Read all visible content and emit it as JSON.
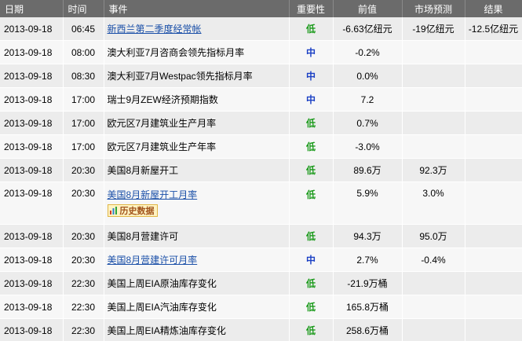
{
  "headers": {
    "date": "日期",
    "time": "时间",
    "event": "事件",
    "importance": "重要性",
    "previous": "前值",
    "forecast": "市场预测",
    "actual": "结果"
  },
  "history_badge": "历史数据",
  "rows": [
    {
      "date": "2013-09-18",
      "time": "06:45",
      "event": "新西兰第二季度经常帐",
      "importance": "低",
      "previous": "-6.63亿纽元",
      "forecast": "-19亿纽元",
      "actual": "-12.5亿纽元"
    },
    {
      "date": "2013-09-18",
      "time": "08:00",
      "event": "澳大利亚7月咨商会领先指标月率",
      "importance": "中",
      "previous": "-0.2%",
      "forecast": "",
      "actual": ""
    },
    {
      "date": "2013-09-18",
      "time": "08:30",
      "event": "澳大利亚7月Westpac领先指标月率",
      "importance": "中",
      "previous": "0.0%",
      "forecast": "",
      "actual": ""
    },
    {
      "date": "2013-09-18",
      "time": "17:00",
      "event": "瑞士9月ZEW经济预期指数",
      "importance": "中",
      "previous": "7.2",
      "forecast": "",
      "actual": ""
    },
    {
      "date": "2013-09-18",
      "time": "17:00",
      "event": "欧元区7月建筑业生产月率",
      "importance": "低",
      "previous": "0.7%",
      "forecast": "",
      "actual": ""
    },
    {
      "date": "2013-09-18",
      "time": "17:00",
      "event": "欧元区7月建筑业生产年率",
      "importance": "低",
      "previous": "-3.0%",
      "forecast": "",
      "actual": ""
    },
    {
      "date": "2013-09-18",
      "time": "20:30",
      "event": "美国8月新屋开工",
      "importance": "低",
      "previous": "89.6万",
      "forecast": "92.3万",
      "actual": ""
    },
    {
      "date": "2013-09-18",
      "time": "20:30",
      "event": "美国8月新屋开工月率",
      "importance": "低",
      "previous": "5.9%",
      "forecast": "3.0%",
      "actual": ""
    },
    {
      "date": "2013-09-18",
      "time": "20:30",
      "event": "美国8月营建许可",
      "importance": "低",
      "previous": "94.3万",
      "forecast": "95.0万",
      "actual": ""
    },
    {
      "date": "2013-09-18",
      "time": "20:30",
      "event": "美国8月营建许可月率",
      "importance": "中",
      "previous": "2.7%",
      "forecast": "-0.4%",
      "actual": ""
    },
    {
      "date": "2013-09-18",
      "time": "22:30",
      "event": "美国上周EIA原油库存变化",
      "importance": "低",
      "previous": "-21.9万桶",
      "forecast": "",
      "actual": ""
    },
    {
      "date": "2013-09-18",
      "time": "22:30",
      "event": "美国上周EIA汽油库存变化",
      "importance": "低",
      "previous": "165.8万桶",
      "forecast": "",
      "actual": ""
    },
    {
      "date": "2013-09-18",
      "time": "22:30",
      "event": "美国上周EIA精炼油库存变化",
      "importance": "低",
      "previous": "258.6万桶",
      "forecast": "",
      "actual": ""
    }
  ],
  "colors": {
    "header_bg": "#6b6b6b",
    "row_odd": "#ececec",
    "row_even": "#f7f7f7",
    "importance_low": "#1b9a1b",
    "importance_mid": "#1a3fc4",
    "link": "#1a4fa8"
  }
}
